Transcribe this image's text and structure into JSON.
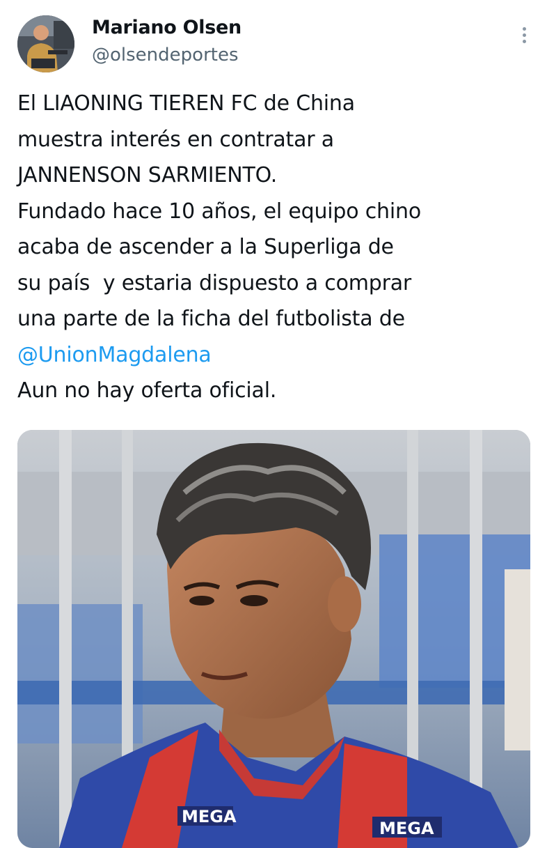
{
  "author": {
    "name": "Mariano Olsen",
    "handle": "@olsendeportes"
  },
  "menu": {
    "icon": "more-vertical-icon"
  },
  "tweet": {
    "lines": [
      "El LIAONING TIEREN FC de China",
      "muestra interés en contratar a",
      "JANNENSON SARMIENTO.",
      "Fundado hace 10 años, el equipo chino",
      "acaba de ascender a la Superliga de",
      "su país  y estaria dispuesto a comprar",
      "una parte de la ficha del futbolista de"
    ],
    "mention": "@UnionMagdalena",
    "closing": "Aun no hay oferta oficial."
  },
  "media": {
    "jersey_text_left": "MEGA",
    "jersey_text_right": "MEGA"
  },
  "colors": {
    "text": "#0f1419",
    "secondary": "#536471",
    "link": "#1d9bf0"
  }
}
